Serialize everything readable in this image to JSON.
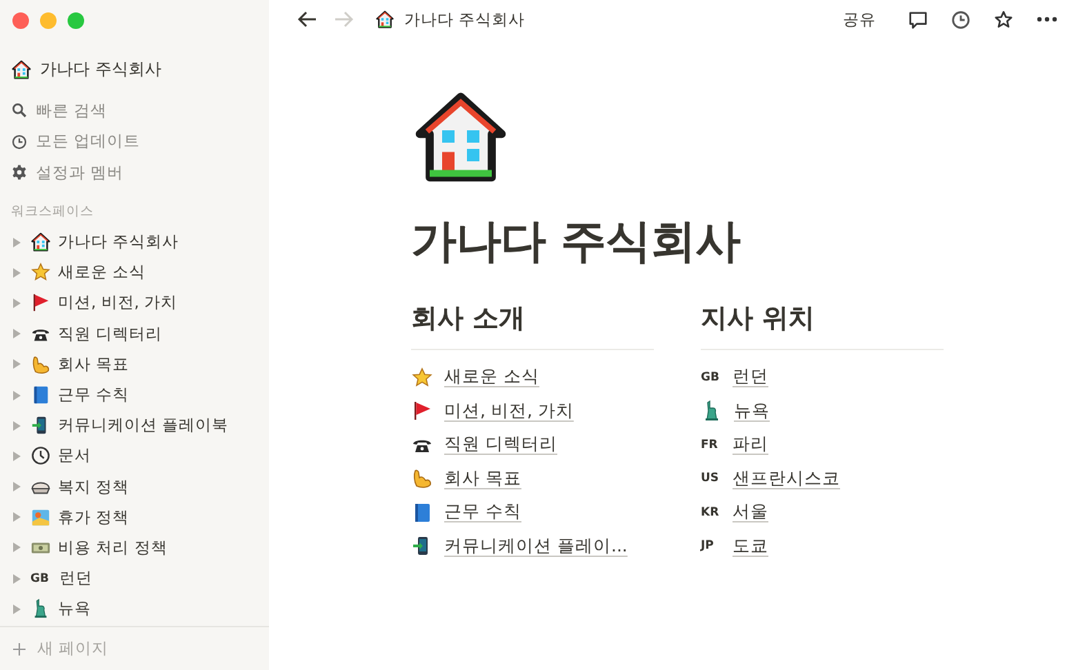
{
  "sidebar": {
    "workspace": "가나다 주식회사",
    "actions": [
      {
        "label": "빠른 검색"
      },
      {
        "label": "모든 업데이트"
      },
      {
        "label": "설정과 멤버"
      }
    ],
    "section_label": "워크스페이스",
    "pages": [
      {
        "label": "가나다 주식회사",
        "expanded": false
      },
      {
        "label": "새로운 소식",
        "expanded": false
      },
      {
        "label": "미션, 비전, 가치",
        "expanded": false
      },
      {
        "label": "직원 디렉터리",
        "expanded": false
      },
      {
        "label": "회사 목표",
        "expanded": false
      },
      {
        "label": "근무 수칙",
        "expanded": false
      },
      {
        "label": "커뮤니케이션 플레이북",
        "expanded": false
      },
      {
        "label": "문서",
        "expanded": false
      },
      {
        "label": "복지 정책",
        "expanded": false
      },
      {
        "label": "휴가 정책",
        "expanded": false
      },
      {
        "label": "비용 처리 정책",
        "expanded": false
      },
      {
        "label": "런던",
        "code": "GB",
        "expanded": false
      },
      {
        "label": "뉴욕",
        "expanded": false
      }
    ],
    "new_page": "새 페이지"
  },
  "topbar": {
    "back_disabled": false,
    "forward_disabled": true,
    "breadcrumb": "가나다 주식회사",
    "share": "공유"
  },
  "page": {
    "title": "가나다 주식회사",
    "columns": [
      {
        "heading": "회사 소개",
        "links": [
          {
            "label": "새로운 소식"
          },
          {
            "label": "미션, 비전, 가치"
          },
          {
            "label": "직원 디렉터리"
          },
          {
            "label": "회사 목표"
          },
          {
            "label": "근무 수칙"
          },
          {
            "label": "커뮤니케이션 플레이..."
          }
        ]
      },
      {
        "heading": "지사 위치",
        "links": [
          {
            "label": "런던",
            "code": "GB"
          },
          {
            "label": "뉴욕"
          },
          {
            "label": "파리",
            "code": "FR"
          },
          {
            "label": "샌프란시스코",
            "code": "US"
          },
          {
            "label": "서울",
            "code": "KR"
          },
          {
            "label": "도쿄",
            "code": "JP"
          }
        ]
      }
    ]
  }
}
